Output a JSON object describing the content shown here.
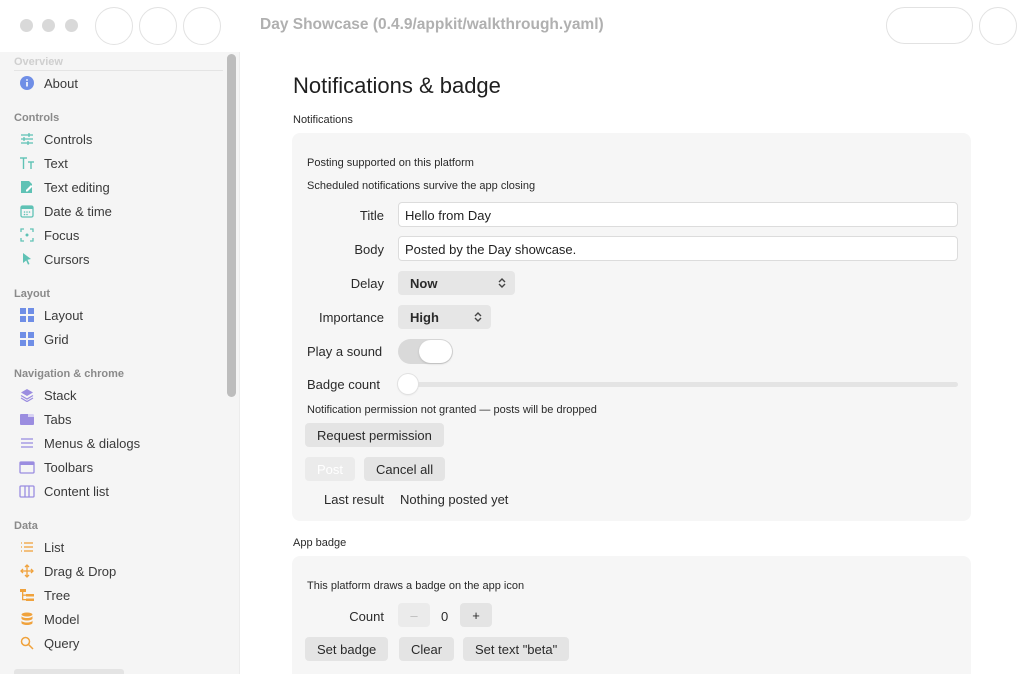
{
  "window": {
    "title": "Day Showcase (0.4.9/appkit/walkthrough.yaml)"
  },
  "sidebar": {
    "sections": [
      {
        "label": "Overview"
      },
      {
        "label": "Controls"
      },
      {
        "label": "Layout"
      },
      {
        "label": "Navigation & chrome"
      },
      {
        "label": "Data"
      }
    ],
    "items": [
      {
        "label": "About",
        "icon": "info-circle-icon"
      },
      {
        "label": "Controls",
        "icon": "sliders-icon"
      },
      {
        "label": "Text",
        "icon": "text-format-icon"
      },
      {
        "label": "Text editing",
        "icon": "edit-document-icon"
      },
      {
        "label": "Date & time",
        "icon": "calendar-icon"
      },
      {
        "label": "Focus",
        "icon": "focus-icon"
      },
      {
        "label": "Cursors",
        "icon": "cursor-arrow-icon"
      },
      {
        "label": "Layout",
        "icon": "layout-grid-icon"
      },
      {
        "label": "Grid",
        "icon": "grid-icon"
      },
      {
        "label": "Stack",
        "icon": "stack-icon"
      },
      {
        "label": "Tabs",
        "icon": "tabs-icon"
      },
      {
        "label": "Menus & dialogs",
        "icon": "menu-lines-icon"
      },
      {
        "label": "Toolbars",
        "icon": "toolbar-window-icon"
      },
      {
        "label": "Content list",
        "icon": "columns-icon"
      },
      {
        "label": "List",
        "icon": "list-icon"
      },
      {
        "label": "Drag & Drop",
        "icon": "move-arrows-icon"
      },
      {
        "label": "Tree",
        "icon": "tree-icon"
      },
      {
        "label": "Model",
        "icon": "database-icon"
      },
      {
        "label": "Query",
        "icon": "search-icon"
      }
    ]
  },
  "main": {
    "title": "Notifications & badge",
    "notifications": {
      "group_label": "Notifications",
      "support_note": "Posting supported on this platform",
      "survive_note": "Scheduled notifications survive the app closing",
      "title_label": "Title",
      "title_value": "Hello from Day",
      "body_label": "Body",
      "body_value": "Posted by the Day showcase.",
      "delay_label": "Delay",
      "delay_value": "Now",
      "importance_label": "Importance",
      "importance_value": "High",
      "sound_label": "Play a sound",
      "sound_on": true,
      "badge_count_label": "Badge count",
      "badge_count_fraction": 0,
      "permission_note": "Notification permission not granted — posts will be dropped",
      "request_button": "Request permission",
      "post_button": "Post",
      "cancel_all_button": "Cancel all",
      "last_result_label": "Last result",
      "last_result_value": "Nothing posted yet"
    },
    "app_badge": {
      "group_label": "App badge",
      "platform_note": "This platform draws a badge on the app icon",
      "count_label": "Count",
      "decrement_label": "–",
      "count_value": "0",
      "increment_label": "+",
      "set_badge_button": "Set badge",
      "clear_button": "Clear",
      "set_text_button": "Set text \"beta\""
    }
  },
  "colors": {
    "sidebar_bg": "#f5f5f5",
    "card_bg": "#f6f6f6",
    "icon_blue": "#6f8ee6",
    "icon_teal": "#5fc2b5",
    "icon_purple": "#9b8de0",
    "icon_orange": "#f0a23c"
  }
}
